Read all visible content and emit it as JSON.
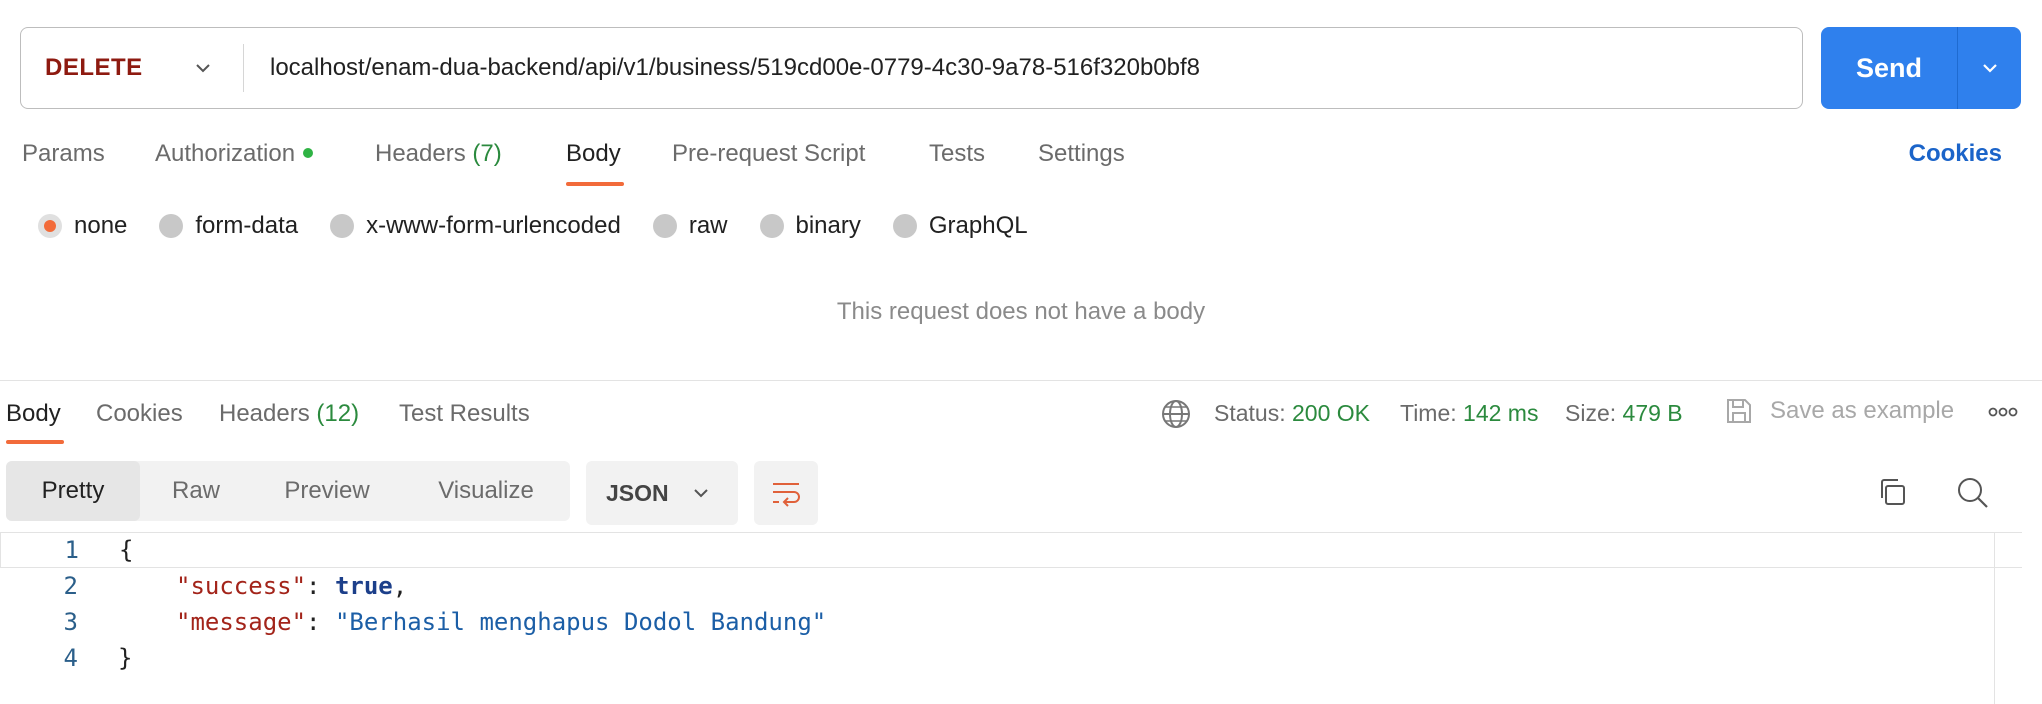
{
  "request": {
    "method": "DELETE",
    "url": "localhost/enam-dua-backend/api/v1/business/519cd00e-0779-4c30-9a78-516f320b0bf8",
    "send_label": "Send"
  },
  "request_tabs": {
    "params": "Params",
    "authorization": "Authorization",
    "headers": "Headers",
    "headers_count": "(7)",
    "body": "Body",
    "pre_request": "Pre-request Script",
    "tests": "Tests",
    "settings": "Settings",
    "cookies": "Cookies"
  },
  "body_types": {
    "none": "none",
    "form_data": "form-data",
    "urlencoded": "x-www-form-urlencoded",
    "raw": "raw",
    "binary": "binary",
    "graphql": "GraphQL",
    "selected": "none"
  },
  "no_body_message": "This request does not have a body",
  "response_tabs": {
    "body": "Body",
    "cookies": "Cookies",
    "headers": "Headers",
    "headers_count": "(12)",
    "test_results": "Test Results"
  },
  "response_meta": {
    "status_label": "Status:",
    "status_value": "200 OK",
    "time_label": "Time:",
    "time_value": "142 ms",
    "size_label": "Size:",
    "size_value": "479 B",
    "save_example": "Save as example"
  },
  "view_modes": {
    "pretty": "Pretty",
    "raw": "Raw",
    "preview": "Preview",
    "visualize": "Visualize",
    "language": "JSON"
  },
  "code": {
    "line_numbers": [
      "1",
      "2",
      "3",
      "4"
    ],
    "open_brace": "{",
    "key_success": "\"success\"",
    "val_success": "true",
    "key_message": "\"message\"",
    "val_message": "\"Berhasil menghapus Dodol Bandung\"",
    "close_brace": "}"
  },
  "colors": {
    "accent_orange": "#f26b3a",
    "send_blue": "#2f80ed",
    "method_red": "#8e1a10",
    "status_green": "#2b8a3e"
  }
}
